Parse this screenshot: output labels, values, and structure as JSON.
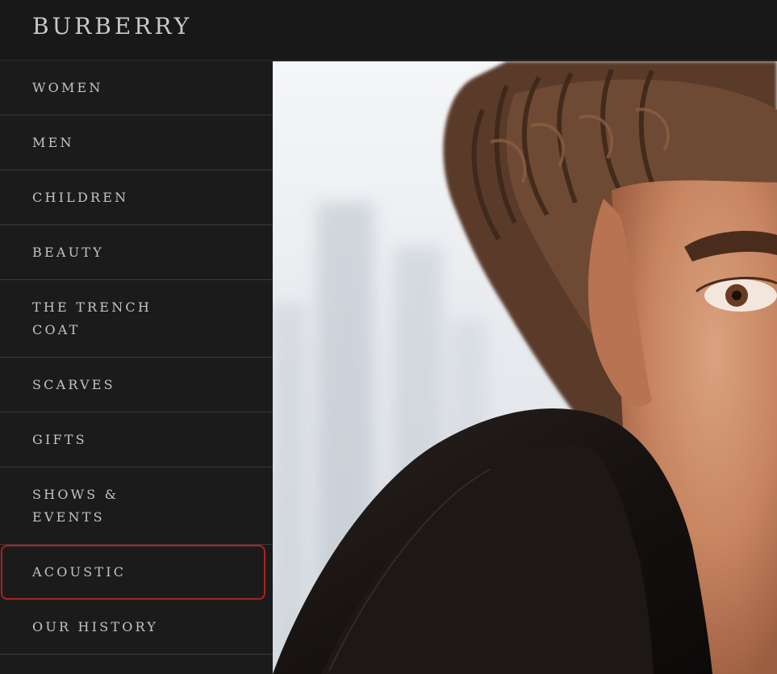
{
  "header": {
    "brand": "BURBERRY"
  },
  "sidebar": {
    "items": [
      {
        "label": "WOMEN"
      },
      {
        "label": "MEN"
      },
      {
        "label": "CHILDREN"
      },
      {
        "label": "BEAUTY"
      },
      {
        "label": "THE TRENCH COAT"
      },
      {
        "label": "SCARVES"
      },
      {
        "label": "GIFTS"
      },
      {
        "label": "SHOWS & EVENTS"
      },
      {
        "label": "ACOUSTIC",
        "selected": true
      },
      {
        "label": "OUR HISTORY"
      }
    ]
  },
  "hero": {
    "subject": "man-with-curly-hair-dark-coat"
  },
  "colors": {
    "background": "#1b1b1b",
    "text": "#c4c4c4",
    "highlight": "#b01f1f"
  }
}
